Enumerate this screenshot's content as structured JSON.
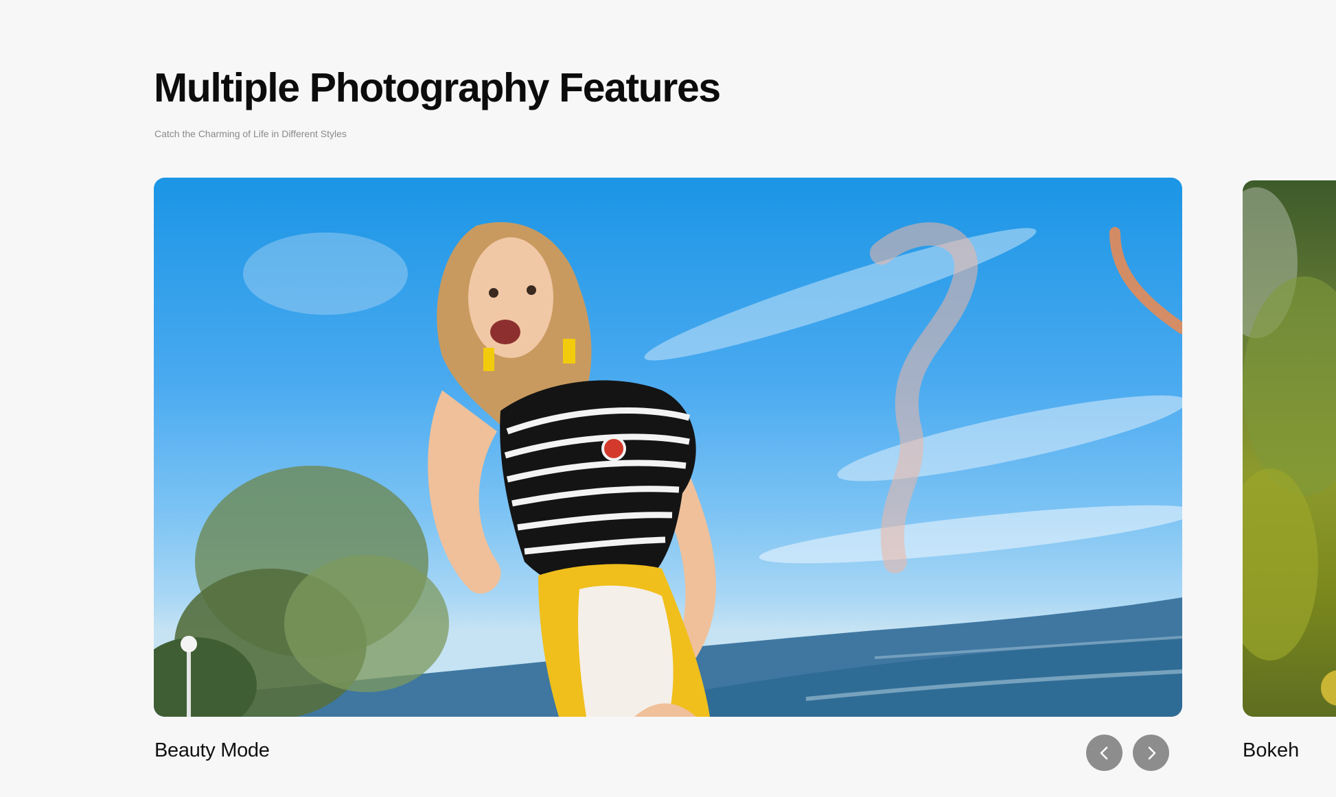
{
  "section": {
    "title": "Multiple Photography Features",
    "subtitle": "Catch the Charming of Life in Different Styles"
  },
  "carousel": {
    "slides": [
      {
        "label": "Beauty Mode",
        "image": "beach-portrait-photo"
      },
      {
        "label": "Bokeh",
        "image": "green-foliage-photo"
      }
    ],
    "prev_icon": "chevron-left-icon",
    "next_icon": "chevron-right-icon"
  },
  "colors": {
    "background": "#f7f7f7",
    "nav_button": "#8d8d8d",
    "heading": "#0c0c0c",
    "subtitle": "#8a8a8a"
  }
}
